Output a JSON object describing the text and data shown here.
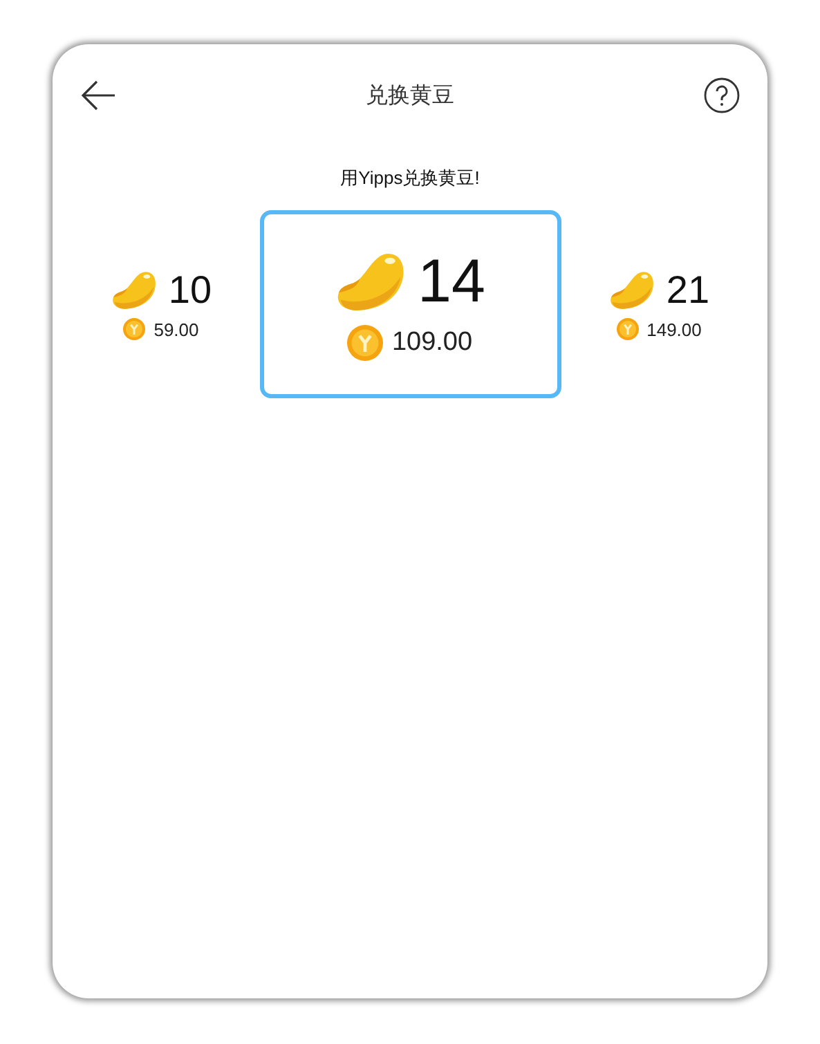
{
  "header": {
    "title": "兑换黄豆"
  },
  "subtitle": "用Yipps兑换黄豆!",
  "options": [
    {
      "beans": "10",
      "price": "59.00",
      "selected": false
    },
    {
      "beans": "14",
      "price": "109.00",
      "selected": true
    },
    {
      "beans": "21",
      "price": "149.00",
      "selected": false
    }
  ]
}
